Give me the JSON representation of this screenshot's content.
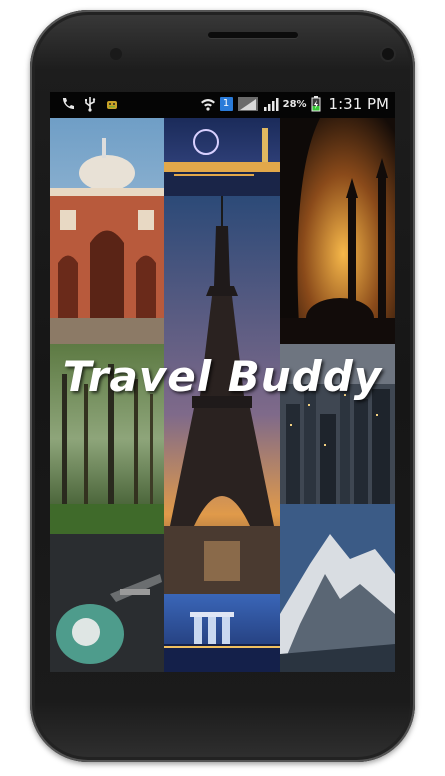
{
  "app": {
    "title": "Travel Buddy"
  },
  "status_bar": {
    "left_icons": [
      "phone-icon",
      "usb-icon",
      "android-debug-icon"
    ],
    "wifi_badge": "1",
    "battery_percent": "28%",
    "time": "1:31 PM"
  },
  "collage": {
    "tiles": [
      "Humayun's Tomb",
      "London skyline at night",
      "Eiffel Tower",
      "Mosque silhouette at sunset",
      "Misty forest",
      "City skyline at night",
      "Vintage scooter",
      "Snowy mountain peak",
      "Marina Bay Sands at night"
    ]
  }
}
